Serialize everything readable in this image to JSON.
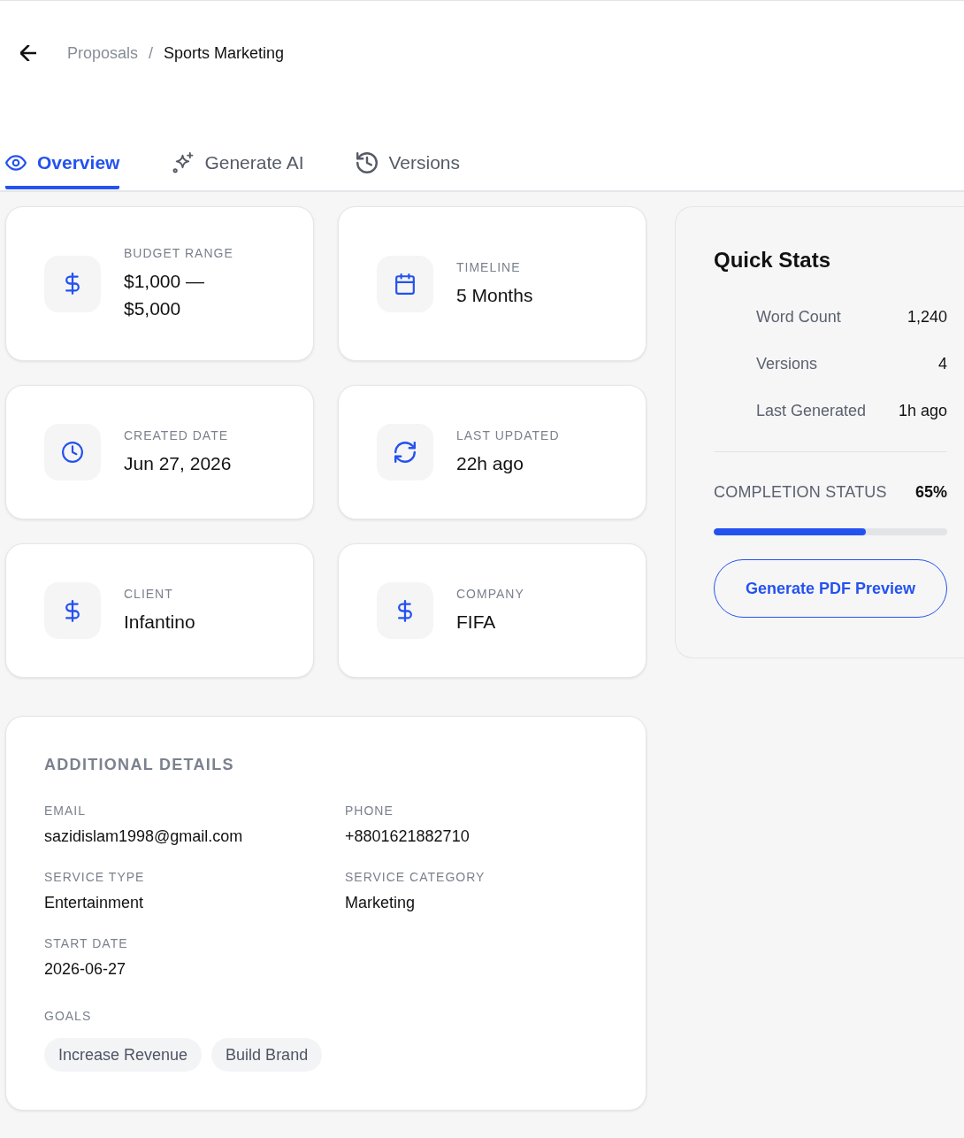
{
  "breadcrumb": {
    "parent": "Proposals",
    "separator": "/",
    "current": "Sports Marketing"
  },
  "tabs": [
    {
      "label": "Overview",
      "selected": true
    },
    {
      "label": "Generate AI",
      "selected": false
    },
    {
      "label": "Versions",
      "selected": false
    }
  ],
  "info_cards": [
    {
      "label": "BUDGET RANGE",
      "value": "$1,000 — $5,000"
    },
    {
      "label": "TIMELINE",
      "value": "5 Months"
    },
    {
      "label": "CREATED DATE",
      "value": "Jun 27, 2026"
    },
    {
      "label": "LAST UPDATED",
      "value": "22h ago"
    },
    {
      "label": "CLIENT",
      "value": "Infantino"
    },
    {
      "label": "COMPANY",
      "value": "FIFA"
    }
  ],
  "additional_details": {
    "title": "ADDITIONAL DETAILS",
    "fields": [
      {
        "label": "EMAIL",
        "value": "sazidislam1998@gmail.com"
      },
      {
        "label": "PHONE",
        "value": "+8801621882710"
      },
      {
        "label": "SERVICE TYPE",
        "value": "Entertainment"
      },
      {
        "label": "SERVICE CATEGORY",
        "value": "Marketing"
      },
      {
        "label": "START DATE",
        "value": "2026-06-27"
      }
    ],
    "goals": {
      "label": "GOALS",
      "tags": [
        "Increase Revenue",
        "Build Brand"
      ]
    }
  },
  "quick_stats": {
    "title": "Quick Stats",
    "stats": [
      {
        "label": "Word Count",
        "value": "1,240"
      },
      {
        "label": "Versions",
        "value": "4"
      },
      {
        "label": "Last Generated",
        "value": "1h ago"
      }
    ],
    "completion": {
      "label": "COMPLETION STATUS",
      "reading": "65%",
      "level": 0.65
    },
    "button": "Generate PDF Preview"
  }
}
